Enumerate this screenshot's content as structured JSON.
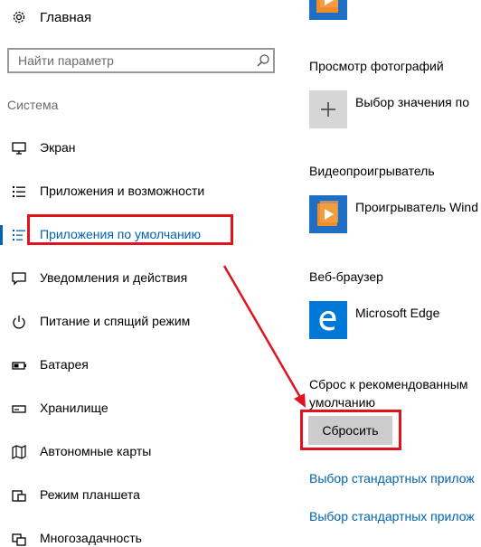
{
  "sidebar": {
    "home_label": "Главная",
    "search": {
      "placeholder": "Найти параметр"
    },
    "section_title": "Система",
    "items": [
      {
        "label": "Экран",
        "icon": "display-icon"
      },
      {
        "label": "Приложения и возможности",
        "icon": "apps-list-icon"
      },
      {
        "label": "Приложения по умолчанию",
        "icon": "default-apps-icon",
        "active": true
      },
      {
        "label": "Уведомления и действия",
        "icon": "notifications-icon"
      },
      {
        "label": "Питание и спящий режим",
        "icon": "power-icon"
      },
      {
        "label": "Батарея",
        "icon": "battery-icon"
      },
      {
        "label": "Хранилище",
        "icon": "storage-icon"
      },
      {
        "label": "Автономные карты",
        "icon": "offline-maps-icon"
      },
      {
        "label": "Режим планшета",
        "icon": "tablet-mode-icon"
      },
      {
        "label": "Многозадачность",
        "icon": "multitasking-icon"
      }
    ]
  },
  "main": {
    "photo_viewer": {
      "label": "Просмотр фотографий",
      "app": "Выбор значения по"
    },
    "video_player": {
      "label": "Видеопроигрыватель",
      "app": "Проигрыватель Wind"
    },
    "web_browser": {
      "label": "Веб-браузер",
      "app": "Microsoft Edge"
    },
    "reset": {
      "description_line1": "Сброс к рекомендованным",
      "description_line2": "умолчанию",
      "button_label": "Сбросить"
    },
    "links": [
      "Выбор стандартных прилож",
      "Выбор стандартных прилож"
    ]
  },
  "colors": {
    "accent": "#0063b1",
    "annotation_red": "#e0141e",
    "edge_tile": "#0078d7",
    "button_gray": "#cccccc"
  }
}
